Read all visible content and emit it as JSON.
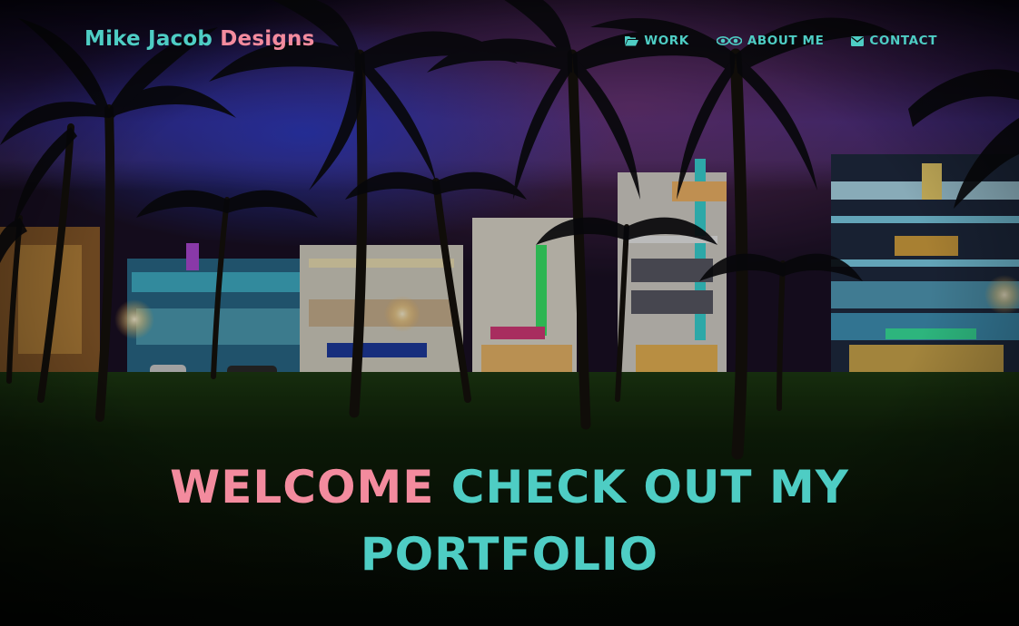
{
  "brand": {
    "part1": "Mike Jacob",
    "part2": "Designs"
  },
  "nav": [
    {
      "label": "WORK",
      "icon": "folder-open-icon"
    },
    {
      "label": "ABOUT ME",
      "icon": "eyes-icon"
    },
    {
      "label": "CONTACT",
      "icon": "envelope-icon"
    }
  ],
  "hero": {
    "welcome": "WELCOME",
    "line1": "CHECK OUT MY",
    "line2": "PORTFOLIO"
  },
  "colors": {
    "teal": "#4ecdc4",
    "pink": "#f38b9e"
  }
}
